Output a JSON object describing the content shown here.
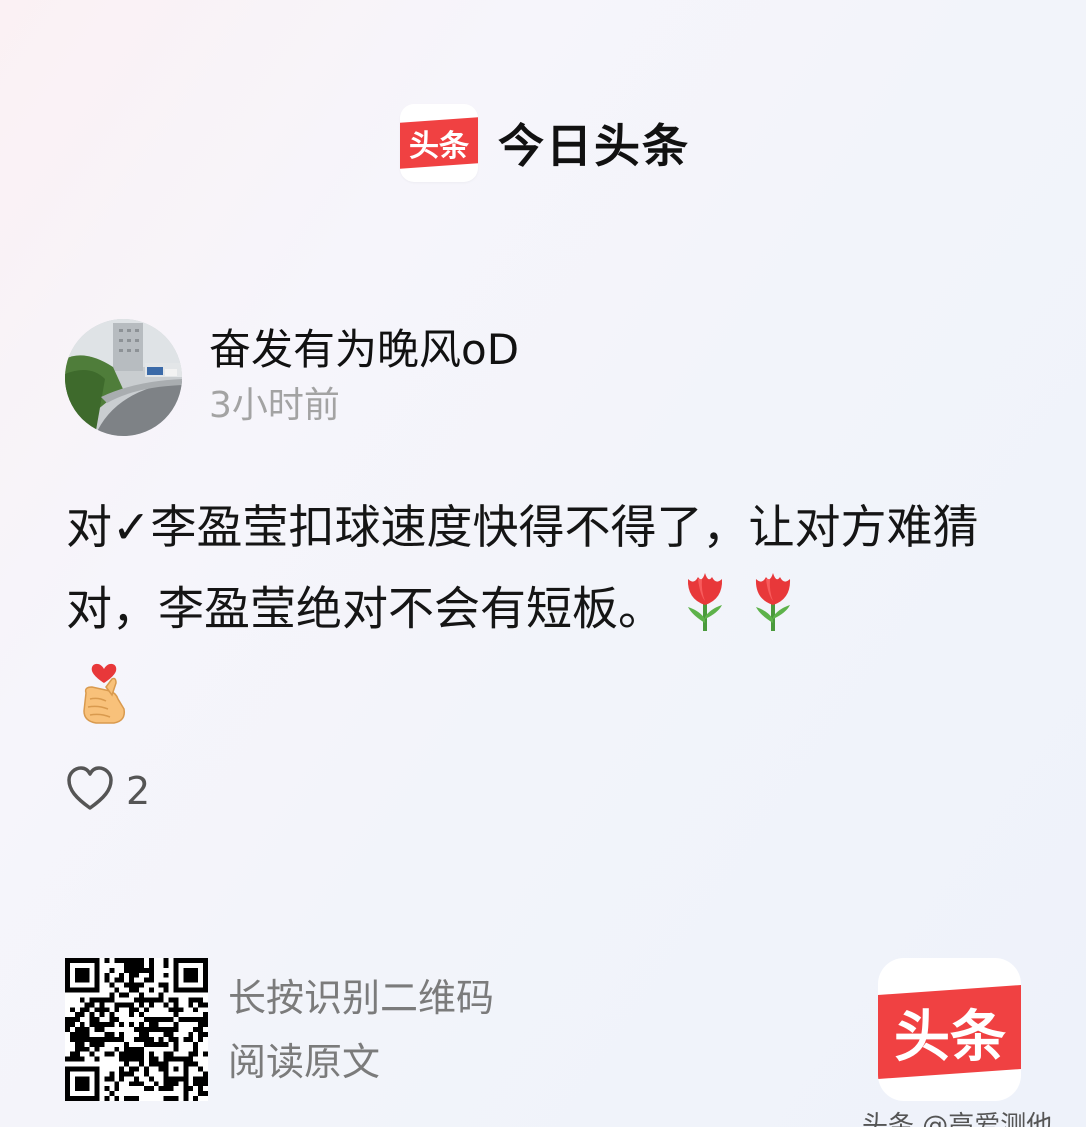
{
  "header": {
    "logo_text": "头条",
    "brand_name": "今日头条"
  },
  "post": {
    "author_name": "奋发有为晚风oD",
    "time": "3小时前",
    "text": "对✓李盈莹扣球速度快得不得了，让对方难猜对，李盈莹绝对不会有短板。",
    "emojis": [
      "tulip",
      "tulip",
      "finger-heart"
    ],
    "likes": "2"
  },
  "footer": {
    "qr_line1": "长按识别二维码",
    "qr_line2": "阅读原文",
    "app_icon_text": "头条",
    "watermark": "头条 @高爱测他"
  },
  "colors": {
    "brand_red": "#f04142",
    "muted_text": "#a3a3a3"
  }
}
